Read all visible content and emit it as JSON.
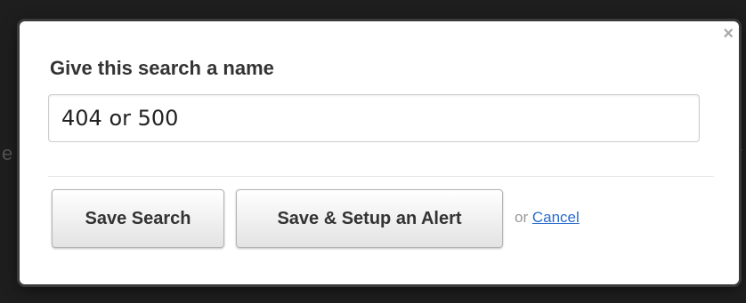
{
  "dialog": {
    "close_glyph": "×",
    "close_icon": "close-icon",
    "title": "Give this search a name",
    "name_input_value": "404 or 500",
    "save_search_label": "Save Search",
    "save_alert_label": "Save & Setup an Alert",
    "or_text": "or",
    "cancel_label": "Cancel"
  },
  "colors": {
    "link": "#2a6ccf",
    "title_text": "#333333",
    "backdrop": "#1e1e1e"
  }
}
